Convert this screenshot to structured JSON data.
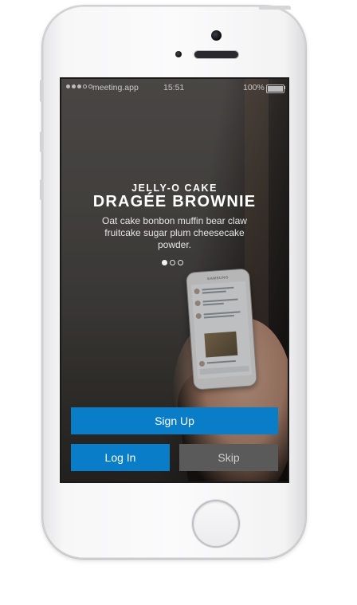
{
  "status_bar": {
    "carrier": "meeting.app",
    "time": "15:51",
    "battery": "100%"
  },
  "onboarding": {
    "kicker": "JELLY-O CAKE",
    "headline": "DRAGÉE BROWNIE",
    "description": "Oat cake bonbon muffin bear claw fruitcake sugar plum cheesecake powder.",
    "pager": {
      "count": 3,
      "active_index": 0
    }
  },
  "illustration": {
    "device_brand": "SAMSUNG"
  },
  "actions": {
    "signup_label": "Sign Up",
    "login_label": "Log In",
    "skip_label": "Skip"
  },
  "colors": {
    "primary": "#0a7dc8",
    "secondary_button": "#5a5a5a"
  }
}
